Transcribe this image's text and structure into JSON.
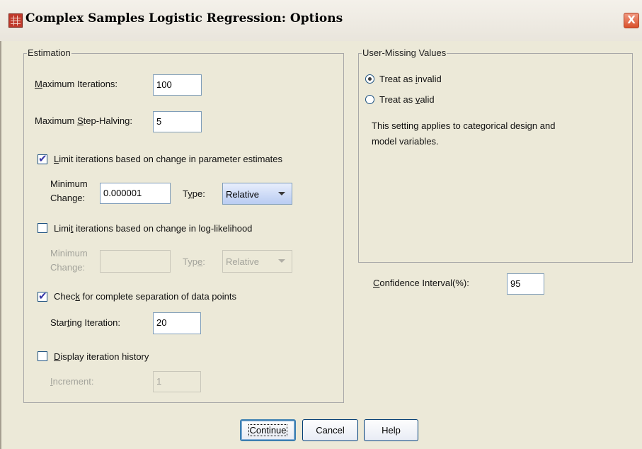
{
  "window": {
    "title": "Complex Samples Logistic Regression: Options",
    "close_glyph": "X"
  },
  "estimation": {
    "group_label": "Estimation",
    "max_iterations": {
      "label_prefix": "",
      "label_accel": "M",
      "label_rest": "aximum Iterations:",
      "value": "100"
    },
    "max_step_halving": {
      "label_prefix": "Maximum ",
      "label_accel": "S",
      "label_rest": "tep-Halving:",
      "value": "5"
    },
    "limit_param": {
      "checked": true,
      "label_prefix": "",
      "label_accel": "L",
      "label_rest": "imit iterations based on change in parameter estimates",
      "min_change_line1": "Minimum",
      "min_change_line2": "Change:",
      "min_change_value": "0.000001",
      "type_prefix": "T",
      "type_accel": "y",
      "type_rest": "pe:",
      "type_value": "Relative"
    },
    "limit_loglik": {
      "checked": false,
      "label_prefix": "Limi",
      "label_accel": "t",
      "label_rest": " iterations based on change in log-likelihood",
      "min_change_line1": "Minimum",
      "min_change_line2": "Change:",
      "min_change_value": "",
      "type_prefix": "Typ",
      "type_accel": "e",
      "type_rest": ":",
      "type_value": "Relative"
    },
    "separation": {
      "checked": true,
      "label_prefix": "Chec",
      "label_accel": "k",
      "label_rest": " for complete separation of data points",
      "starting_prefix": "Star",
      "starting_accel": "t",
      "starting_rest": "ing Iteration:",
      "starting_value": "20"
    },
    "history": {
      "checked": false,
      "label_prefix": "",
      "label_accel": "D",
      "label_rest": "isplay iteration history",
      "increment_prefix": "",
      "increment_accel": "I",
      "increment_rest": "ncrement:",
      "increment_value": "1"
    }
  },
  "user_missing": {
    "group_label": "User-Missing Values",
    "invalid": {
      "selected": true,
      "label_prefix": "Treat as ",
      "label_accel": "i",
      "label_rest": "nvalid"
    },
    "valid": {
      "selected": false,
      "label_prefix": "Treat as ",
      "label_accel": "v",
      "label_rest": "alid"
    },
    "note_line1": "This setting applies to categorical design and",
    "note_line2": "model variables."
  },
  "confidence": {
    "label_prefix": "",
    "label_accel": "C",
    "label_rest": "onfidence Interval(%):",
    "value": "95"
  },
  "buttons": {
    "continue": "Continue",
    "cancel": "Cancel",
    "help": "Help"
  }
}
